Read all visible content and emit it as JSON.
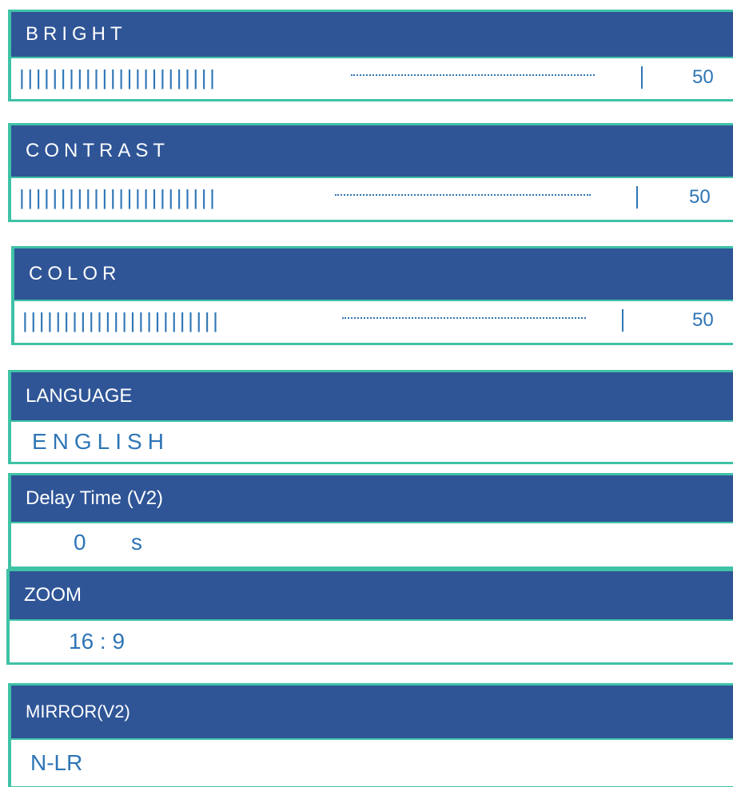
{
  "bright": {
    "label": "BRIGHT",
    "value": "50",
    "level": 50,
    "ticks": "||||||||||||||||||||||||"
  },
  "contrast": {
    "label": "CONTRAST",
    "value": "50",
    "level": 50,
    "ticks": "||||||||||||||||||||||||"
  },
  "color": {
    "label": "COLOR",
    "value": "50",
    "level": 50,
    "ticks": "||||||||||||||||||||||||"
  },
  "language": {
    "label": "LANGUAGE",
    "value": "ENGLISH"
  },
  "delay": {
    "label": "Delay Time (V2)",
    "value": "0",
    "unit": "s"
  },
  "zoom": {
    "label": "ZOOM",
    "value": "16 : 9"
  },
  "mirror": {
    "label": "MIRROR(V2)",
    "value": "N-LR"
  },
  "colors": {
    "header_bg": "#2f5597",
    "border": "#3fc2a6",
    "value_text": "#2e75b6"
  }
}
